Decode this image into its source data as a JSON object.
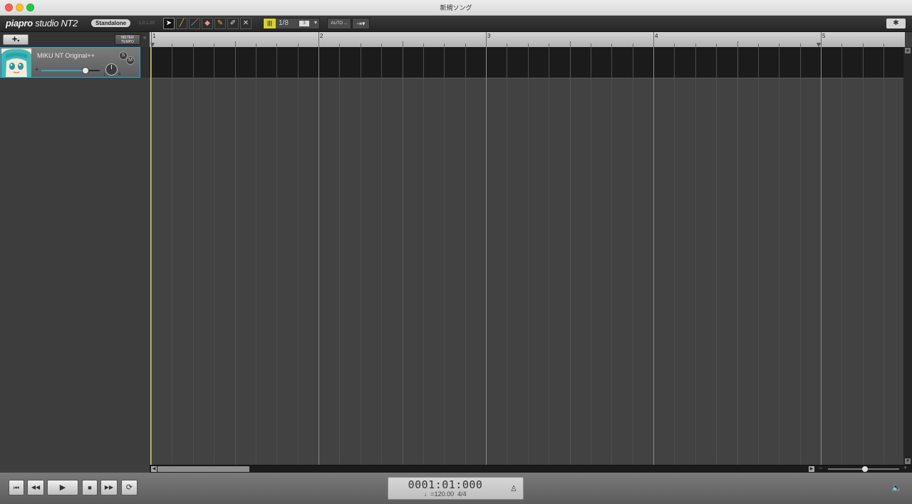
{
  "window": {
    "title": "新規ソング"
  },
  "toolbar": {
    "logo": {
      "brand": "piapro",
      "product": "studio NT2"
    },
    "edition_badge": "Standalone",
    "version": "1.0.1.20",
    "tools": [
      {
        "name": "select-tool",
        "icon": "arrow-cursor-icon",
        "glyph": "➤",
        "active": true
      },
      {
        "name": "pencil-tool",
        "icon": "pencil-icon",
        "glyph": "╱"
      },
      {
        "name": "line-tool",
        "icon": "line-icon",
        "glyph": "／"
      },
      {
        "name": "eraser-tool",
        "icon": "eraser-icon",
        "glyph": "◆"
      },
      {
        "name": "brush-tool",
        "icon": "brush-icon",
        "glyph": "✎"
      },
      {
        "name": "pen-tool",
        "icon": "pen-icon",
        "glyph": "✐"
      },
      {
        "name": "delete-tool",
        "icon": "x-icon",
        "glyph": "✕"
      }
    ],
    "quantize_value": "1/8",
    "quantize_mode": "3",
    "auto_label": "AUTO ...",
    "select_label": "⇥▾",
    "settings_icon": "gear-icon"
  },
  "track_header": {
    "add_label": "+",
    "add_arrow": "▾",
    "meter_label": "METER",
    "tempo_label": "TEMPO",
    "collapse": "«"
  },
  "ruler": {
    "measures": [
      "1",
      "2",
      "3",
      "4",
      "5"
    ]
  },
  "tracks": [
    {
      "name": "MIKU NT Original++",
      "solo_label": "S",
      "mute_label": "M",
      "volume_fraction": 0.75,
      "pan_left": "L",
      "pan_right": "R",
      "volume_min": "◄"
    }
  ],
  "transport": {
    "buttons": [
      {
        "name": "go-to-start-button",
        "glyph": "⏮"
      },
      {
        "name": "rewind-button",
        "glyph": "◀◀"
      },
      {
        "name": "play-button",
        "glyph": "▶"
      },
      {
        "name": "stop-button",
        "glyph": "■"
      },
      {
        "name": "fast-forward-button",
        "glyph": "▶▶"
      },
      {
        "name": "loop-button",
        "glyph": "⟳"
      }
    ],
    "position": "0001:01:000",
    "tempo": "♩=120.00",
    "time_signature": "4/4",
    "metronome_icon": "metronome-icon",
    "speaker_icon": "speaker-icon"
  },
  "zoom": {
    "minus": "–",
    "plus": "+",
    "level_fraction": 0.5
  },
  "colors": {
    "accent": "#2ba8d6",
    "playhead": "#e3d31d",
    "quantize": "#d6d22e"
  }
}
